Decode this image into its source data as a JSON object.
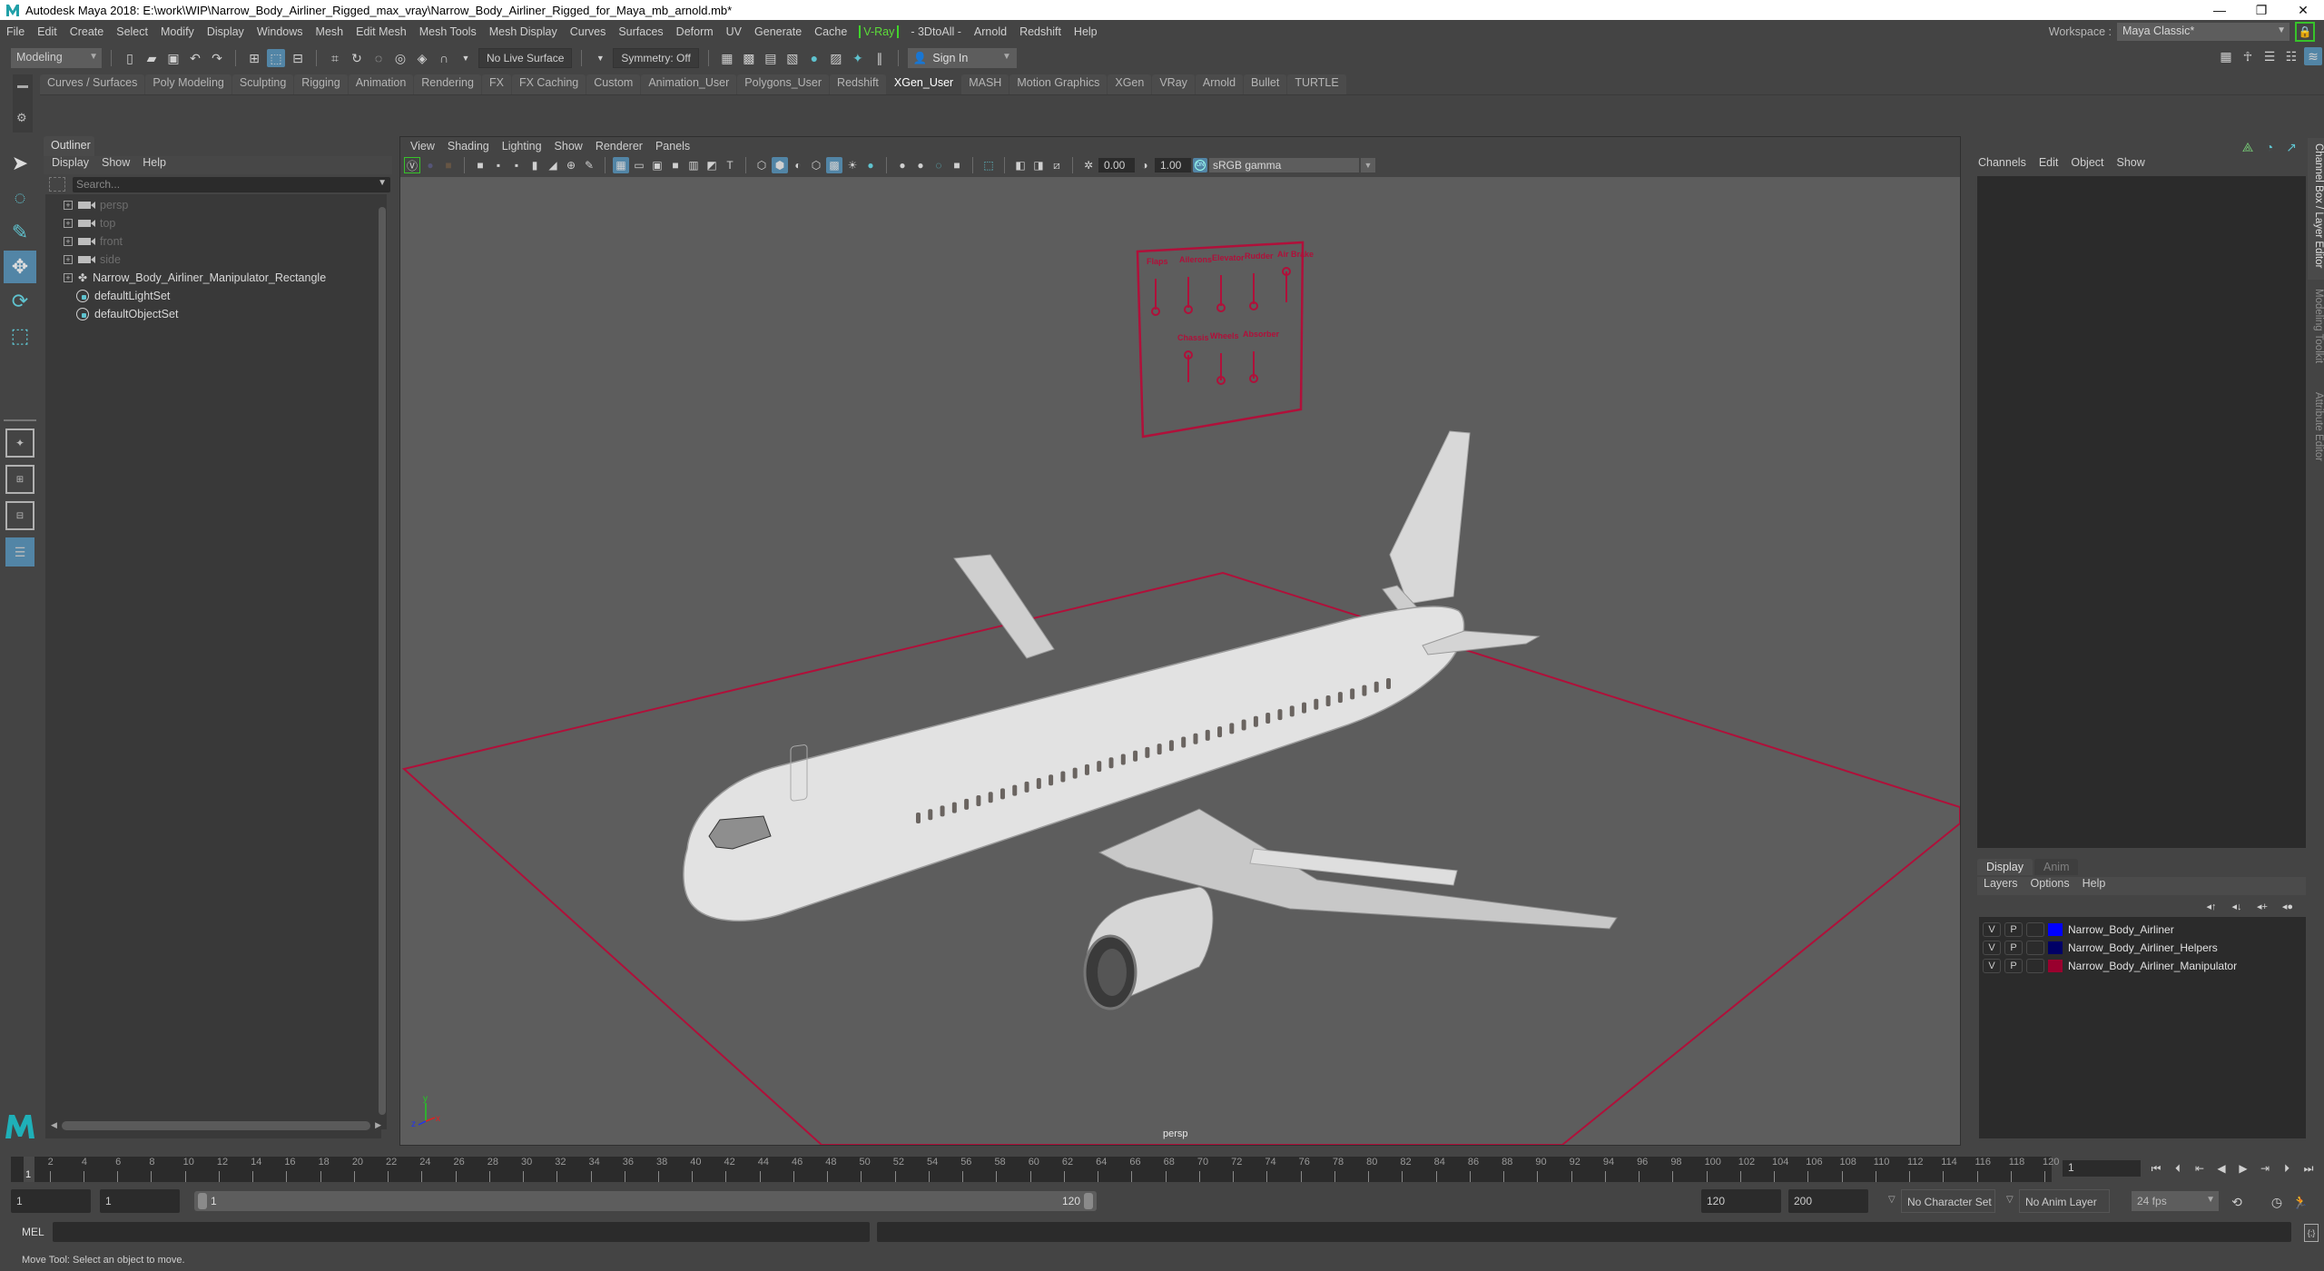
{
  "window": {
    "title": "Autodesk Maya 2018: E:\\work\\WIP\\Narrow_Body_Airliner_Rigged_max_vray\\Narrow_Body_Airliner_Rigged_for_Maya_mb_arnold.mb*",
    "minimize": "—",
    "restore": "❐",
    "close": "✕"
  },
  "menubar": {
    "items": [
      "File",
      "Edit",
      "Create",
      "Select",
      "Modify",
      "Display",
      "Windows",
      "Mesh",
      "Edit Mesh",
      "Mesh Tools",
      "Mesh Display",
      "Curves",
      "Surfaces",
      "Deform",
      "UV",
      "Generate",
      "Cache",
      "V-Ray",
      "- 3DtoAll -",
      "Arnold",
      "Redshift",
      "Help"
    ],
    "workspace_label": "Workspace :",
    "workspace_value": "Maya Classic*"
  },
  "statusline": {
    "mode": "Modeling",
    "live_surface": "No Live Surface",
    "symmetry": "Symmetry: Off",
    "sign_in": "Sign In"
  },
  "shelf": {
    "tabs": [
      "Curves / Surfaces",
      "Poly Modeling",
      "Sculpting",
      "Rigging",
      "Animation",
      "Rendering",
      "FX",
      "FX Caching",
      "Custom",
      "Animation_User",
      "Polygons_User",
      "Redshift",
      "XGen_User",
      "MASH",
      "Motion Graphics",
      "XGen",
      "VRay",
      "Arnold",
      "Bullet",
      "TURTLE"
    ],
    "active_tab": "XGen_User"
  },
  "outliner": {
    "title": "Outliner",
    "menus": [
      "Display",
      "Show",
      "Help"
    ],
    "search_placeholder": "Search...",
    "items": [
      {
        "label": "persp",
        "type": "camera",
        "dim": true
      },
      {
        "label": "top",
        "type": "camera",
        "dim": true
      },
      {
        "label": "front",
        "type": "camera",
        "dim": true
      },
      {
        "label": "side",
        "type": "camera",
        "dim": true
      },
      {
        "label": "Narrow_Body_Airliner_Manipulator_Rectangle",
        "type": "transform",
        "dim": false
      },
      {
        "label": "defaultLightSet",
        "type": "set",
        "dim": false
      },
      {
        "label": "defaultObjectSet",
        "type": "set",
        "dim": false
      }
    ]
  },
  "viewport": {
    "menus": [
      "View",
      "Shading",
      "Lighting",
      "Show",
      "Renderer",
      "Panels"
    ],
    "exposure": "0.00",
    "gamma": "1.00",
    "color_space": "sRGB gamma",
    "camera": "persp",
    "axis": {
      "x": "x",
      "y": "y",
      "z": "z"
    },
    "control_panel": {
      "top_labels": [
        "Flaps",
        "Ailerons",
        "Elevator",
        "Rudder",
        "Air Brake"
      ],
      "bottom_labels": [
        "Chassis",
        "Wheels",
        "Absorber"
      ],
      "color": "#b0103a"
    }
  },
  "channelbox": {
    "menus": [
      "Channels",
      "Edit",
      "Object",
      "Show"
    ]
  },
  "sidetabs": [
    "Channel Box / Layer Editor",
    "Modeling Toolkit",
    "Attribute Editor"
  ],
  "layereditor": {
    "tabs": [
      "Display",
      "Anim"
    ],
    "menus": [
      "Layers",
      "Options",
      "Help"
    ],
    "layers": [
      {
        "v": "V",
        "p": "P",
        "name": "Narrow_Body_Airliner",
        "color": "#0000ff"
      },
      {
        "v": "V",
        "p": "P",
        "name": "Narrow_Body_Airliner_Helpers",
        "color": "#000066"
      },
      {
        "v": "V",
        "p": "P",
        "name": "Narrow_Body_Airliner_Manipulator",
        "color": "#99002e"
      }
    ]
  },
  "timeslider": {
    "start": 1,
    "end": 120,
    "current_frame": "1",
    "current_label": "1"
  },
  "rangeslider": {
    "anim_start": "1",
    "play_start": "1",
    "range_start_label": "1",
    "range_end_label": "120",
    "play_end": "120",
    "anim_end": "200",
    "character_set": "No Character Set",
    "anim_layer": "No Anim Layer",
    "fps": "24 fps"
  },
  "mel": {
    "label": "MEL"
  },
  "helpline": {
    "text": "Move Tool: Select an object to move."
  }
}
